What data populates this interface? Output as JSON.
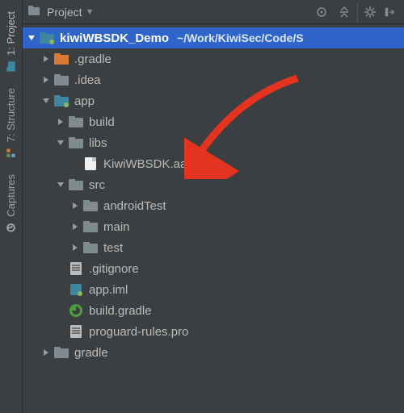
{
  "leftTabs": {
    "project": "1: Project",
    "structure": "7: Structure",
    "captures": "Captures"
  },
  "toolbar": {
    "title": "Project"
  },
  "tree": {
    "root": {
      "name": "kiwiWBSDK_Demo",
      "path": "~/Work/KiwiSec/Code/S"
    },
    "gradleDir": ".gradle",
    "ideaDir": ".idea",
    "app": "app",
    "build": "build",
    "libs": "libs",
    "aar": "KiwiWBSDK.aar",
    "src": "src",
    "androidTest": "androidTest",
    "main": "main",
    "test": "test",
    "gitignore": ".gitignore",
    "iml": "app.iml",
    "buildGradle": "build.gradle",
    "proguard": "proguard-rules.pro",
    "gradleDir2": "gradle"
  }
}
